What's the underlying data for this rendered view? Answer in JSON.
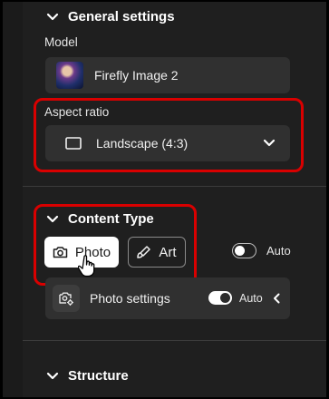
{
  "general_settings": {
    "title": "General settings",
    "model_label": "Model",
    "model_value": "Firefly Image 2",
    "aspect_label": "Aspect ratio",
    "aspect_value": "Landscape (4:3)"
  },
  "content_type": {
    "title": "Content Type",
    "photo_label": "Photo",
    "art_label": "Art",
    "auto_label": "Auto",
    "photo_settings_label": "Photo settings",
    "photo_settings_auto_label": "Auto"
  },
  "structure": {
    "title": "Structure"
  },
  "colors": {
    "panel_bg": "#1f1f1f",
    "card_bg": "#303030",
    "highlight": "#d90000"
  }
}
